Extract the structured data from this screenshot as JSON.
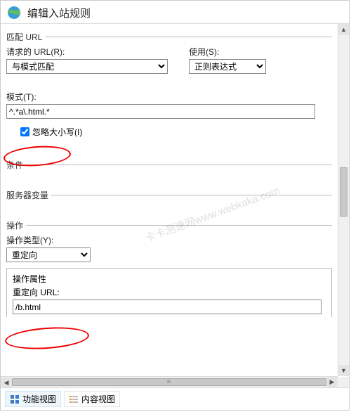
{
  "title": "编辑入站规则",
  "sections": {
    "match": {
      "legend": "匹配 URL",
      "requested_url_label": "请求的 URL(R):",
      "requested_url_value": "与模式匹配",
      "use_label": "使用(S):",
      "use_value": "正则表达式",
      "pattern_label": "模式(T):",
      "pattern_value": "^.*a\\.html.*",
      "ignore_case_label": "忽略大小写(I)"
    },
    "conditions": {
      "legend": "条件"
    },
    "server_vars": {
      "legend": "服务器变量"
    },
    "action": {
      "legend": "操作",
      "action_type_label": "操作类型(Y):",
      "action_type_value": "重定向",
      "action_props_label": "操作属性",
      "redirect_url_label": "重定向 URL:",
      "redirect_url_value": "/b.html"
    }
  },
  "watermark": "卡卡测速网www.webkaka.com",
  "footer": {
    "tab_feature": "功能视图",
    "tab_content": "内容视图"
  }
}
